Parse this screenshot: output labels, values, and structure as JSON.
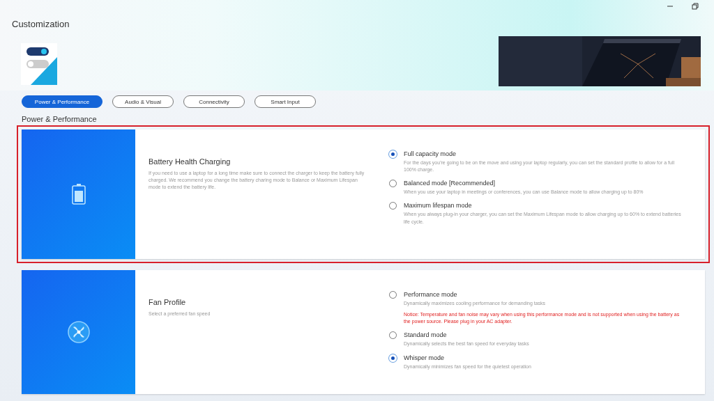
{
  "window": {
    "title": "Customization"
  },
  "tabs": [
    {
      "label": "Power & Performance",
      "selected": true
    },
    {
      "label": "Audio & Visual",
      "selected": false
    },
    {
      "label": "Connectivity",
      "selected": false
    },
    {
      "label": "Smart Input",
      "selected": false
    }
  ],
  "section_title": "Power & Performance",
  "cards": [
    {
      "kind": "battery",
      "highlighted": true,
      "title": "Battery Health Charging",
      "description": "If you need to use a laptop for a long time make sure to connect the charger to keep the battery fully charged. We recommend you change the battery charing mode to Balance or Maximum Lifespan mode to extend the battery life.",
      "options": [
        {
          "label": "Full capacity mode",
          "description": "For the days you're going to be on the move and using your laptop regularly, you can set the standard profile to allow for a full 100% charge.",
          "selected": true
        },
        {
          "label": "Balanced mode [Recommended]",
          "description": "When you use your laptop in meetings or conferences, you can use Balance mode to allow charging up to 80%",
          "selected": false
        },
        {
          "label": "Maximum lifespan mode",
          "description": "When you always plug-in your charger, you can set the Maximum Lifespan mode to allow charging up to 60% to extend batteries life cycle.",
          "selected": false
        }
      ]
    },
    {
      "kind": "fan",
      "highlighted": false,
      "title": "Fan Profile",
      "description": "Select a preferred fan speed",
      "options": [
        {
          "label": "Performance mode",
          "description": "Dynamically maximizes cooling performance for demanding tasks",
          "notice": "Notice: Temperature and fan noise may vary when using this performance mode and is not supported when using the battery as the power source. Please plug in your AC adapter.",
          "selected": false
        },
        {
          "label": "Standard mode",
          "description": "Dynamically selects the best fan speed for everyday tasks",
          "selected": false
        },
        {
          "label": "Whisper mode",
          "description": "Dynamically minimizes fan speed for the quietest operation",
          "selected": true
        }
      ]
    }
  ]
}
